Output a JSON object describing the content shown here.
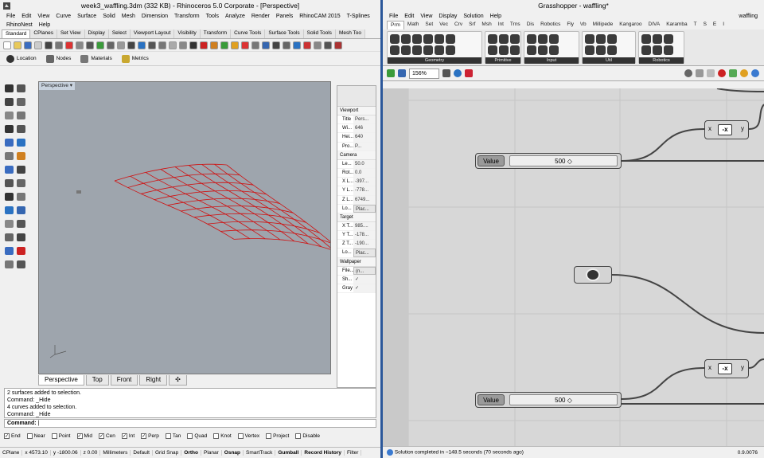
{
  "rhino": {
    "title": "week3_waffling.3dm (332 KB) - Rhinoceros  5.0 Corporate - [Perspective]",
    "menu": [
      "File",
      "Edit",
      "View",
      "Curve",
      "Surface",
      "Solid",
      "Mesh",
      "Dimension",
      "Transform",
      "Tools",
      "Analyze",
      "Render",
      "Panels",
      "RhinoCAM 2015",
      "T-Splines",
      "RhinoNest",
      "Help"
    ],
    "toolbar_tabs": [
      "Standard",
      "CPlanes",
      "Set View",
      "Display",
      "Select",
      "Viewport Layout",
      "Visibility",
      "Transform",
      "Curve Tools",
      "Surface Tools",
      "Solid Tools",
      "Mesh Too"
    ],
    "panels_row": [
      "Location",
      "Nodes",
      "Materials",
      "Metrics"
    ],
    "viewport_label": "Perspective",
    "viewport_tabs": [
      "Perspective",
      "Top",
      "Front",
      "Right"
    ],
    "props": {
      "viewport_header": "Viewport",
      "viewport_rows": [
        [
          "Title",
          "Pers..."
        ],
        [
          "Wi...",
          "646"
        ],
        [
          "Hei...",
          "640"
        ],
        [
          "Pro...",
          "P..."
        ]
      ],
      "camera_header": "Camera",
      "camera_rows": [
        [
          "Le...",
          "50.0"
        ],
        [
          "Rot...",
          "0.0"
        ],
        [
          "X L...",
          "-397..."
        ],
        [
          "Y L...",
          "-778..."
        ],
        [
          "Z L...",
          "6749..."
        ],
        [
          "Lo...",
          "Plac..."
        ]
      ],
      "target_header": "Target",
      "target_rows": [
        [
          "X T...",
          "985...."
        ],
        [
          "Y T...",
          "-178..."
        ],
        [
          "Z T...",
          "-190..."
        ],
        [
          "Lo...",
          "Plac..."
        ]
      ],
      "wallpaper_header": "Wallpaper",
      "wallpaper_rows": [
        [
          "File...",
          "(n..."
        ],
        [
          "Sh...",
          "✓"
        ],
        [
          "Gray",
          "✓"
        ]
      ]
    },
    "command_history": [
      "2 surfaces added to selection.",
      "Command: _Hide",
      "4 curves added to selection.",
      "Command: _Hide"
    ],
    "command_prompt": "Command:",
    "osnaps": [
      [
        "End",
        true
      ],
      [
        "Near",
        false
      ],
      [
        "Point",
        false
      ],
      [
        "Mid",
        true
      ],
      [
        "Cen",
        true
      ],
      [
        "Int",
        true
      ],
      [
        "Perp",
        true
      ],
      [
        "Tan",
        false
      ],
      [
        "Quad",
        false
      ],
      [
        "Knot",
        false
      ],
      [
        "Vertex",
        false
      ],
      [
        "Project",
        false
      ],
      [
        "Disable",
        false
      ]
    ],
    "status": [
      "CPlane",
      "x 4573.10",
      "y -1800.06",
      "z 0.00",
      "Millimeters",
      "Default",
      "Grid Snap",
      "Ortho",
      "Planar",
      "Osnap",
      "SmartTrack",
      "Gumball",
      "Record History",
      "Filter"
    ]
  },
  "gh": {
    "title": "Grasshopper - waffling*",
    "doc_name": "waffling",
    "menu": [
      "File",
      "Edit",
      "View",
      "Display",
      "Solution",
      "Help"
    ],
    "tabs": [
      "Prm",
      "Math",
      "Set",
      "Vec",
      "Crv",
      "Srf",
      "Msh",
      "Int",
      "Trns",
      "Dis",
      "Robotics",
      "Fly",
      "\\rb",
      "Millipede",
      "Kangaroo",
      "DIVA",
      "Karamba",
      "T",
      "S",
      "E",
      "I"
    ],
    "groups": [
      "Geometry",
      "Primitive",
      "Input",
      "Util",
      "Robotics"
    ],
    "zoom": "156%",
    "nodes": {
      "slider1_label": "Value",
      "slider1_value": "500",
      "slider2_label": "Value",
      "slider2_value": "500",
      "neg1_in": "x",
      "neg1_out": "y",
      "neg2_in": "x",
      "neg2_out": "y",
      "neg_symbol": "-x"
    },
    "status_text": "Solution completed in ~148.5 seconds (70 seconds ago)",
    "version": "0.9.0076"
  },
  "colors": {
    "accent": "#2b579a",
    "curve": "#d01010",
    "viewport": "#9ea5ad",
    "gh_canvas": "#d7d7d7"
  }
}
